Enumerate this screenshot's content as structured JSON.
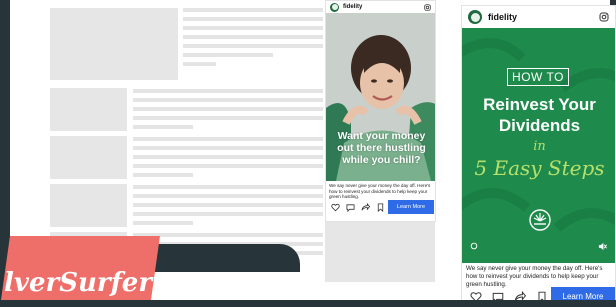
{
  "ads": [
    {
      "brand": "fidelity",
      "headline": [
        "Want your money",
        "out there hustling",
        "while you chill?"
      ],
      "caption": "We say never give your money the day off. Here's how to reinvest your dividends to help keep your green hustling.",
      "cta": "Learn More"
    },
    {
      "brand": "fidelity",
      "badge": "HOW TO",
      "title": [
        "Reinvest Your",
        "Dividends"
      ],
      "script_in": "in",
      "script_steps": "5 Easy Steps",
      "caption": "We say never give your money the day off. Here's how to reinvest your dividends to help keep your green hustling.",
      "cta": "Learn More"
    }
  ],
  "overlay": {
    "logo_text": "lverSurfer"
  },
  "colors": {
    "ad_green": "#1e8a4c",
    "cta_blue": "#2f6be6",
    "badge_coral": "#ee6f6a",
    "dark_bg": "#27343a"
  }
}
